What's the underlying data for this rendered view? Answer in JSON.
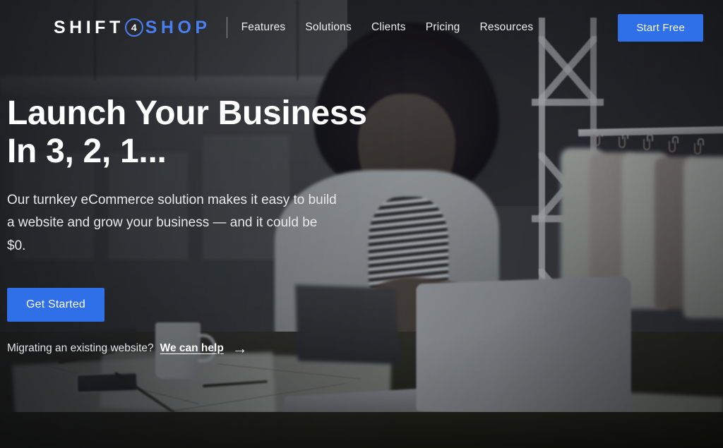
{
  "header": {
    "logo": {
      "part1": "SHIFT",
      "badge": "4",
      "part2": "SHOP",
      "accent": "#4a7ff0"
    },
    "nav": [
      {
        "label": "Features"
      },
      {
        "label": "Solutions"
      },
      {
        "label": "Clients"
      },
      {
        "label": "Pricing"
      },
      {
        "label": "Resources"
      }
    ],
    "cta": {
      "label": "Start Free",
      "color": "#2f6fe8"
    }
  },
  "hero": {
    "headline_line1": "Launch Your Business",
    "headline_line2": "In 3, 2, 1...",
    "subheading": "Our turnkey eCommerce solution makes it easy to build a website and grow your business — and it could be $0.",
    "primary_button": {
      "label": "Get Started",
      "color": "#2f6fe8"
    },
    "migrate_prompt": "Migrating an existing website?",
    "migrate_link": "We can help",
    "migrate_arrow": "→"
  },
  "theme": {
    "accent_blue": "#2f6fe8",
    "logo_blue": "#4a7ff0",
    "overlay_dark": "#2e3038",
    "text_light": "#ffffff"
  }
}
